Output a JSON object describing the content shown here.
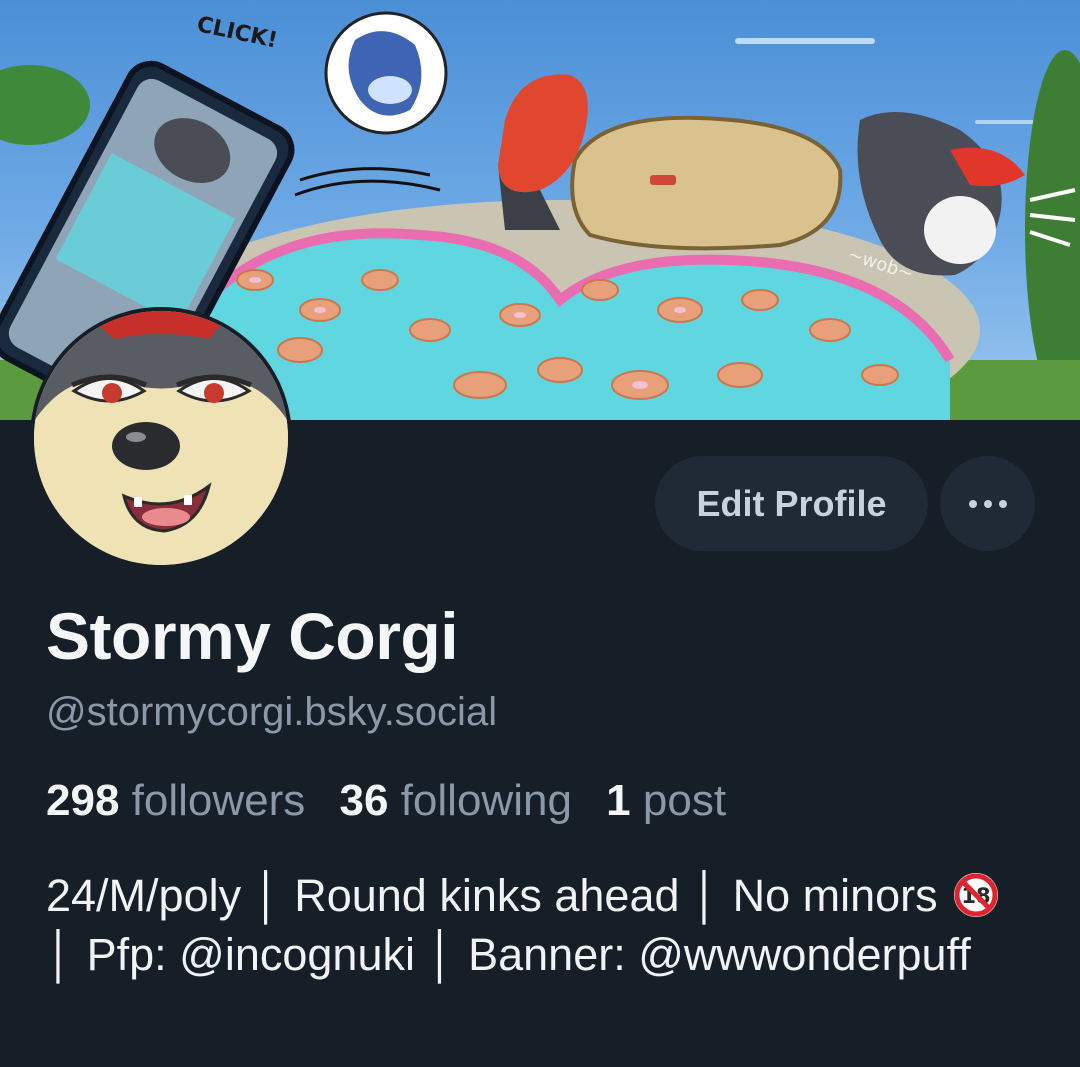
{
  "profile": {
    "display_name": "Stormy Corgi",
    "handle": "@stormycorgi.bsky.social",
    "followers_count": "298",
    "followers_label": "followers",
    "following_count": "36",
    "following_label": "following",
    "posts_count": "1",
    "posts_label": "post",
    "bio_part1": "24/M/poly │ Round kinks ahead │ No minors",
    "bio_icon": "no-under-18-icon",
    "bio_part2": "│ Pfp: @incognuki │ Banner: @wwwonderpuff"
  },
  "actions": {
    "edit_profile_label": "Edit Profile",
    "more_icon": "ellipsis-icon"
  },
  "banner": {
    "sound_effect_1": "CLICK!",
    "sound_effect_2": "~wob~"
  },
  "colors": {
    "background": "#161e27",
    "button_bg": "#1f2a36",
    "muted_text": "#8b98a8",
    "primary_text": "#f4f6f8"
  }
}
